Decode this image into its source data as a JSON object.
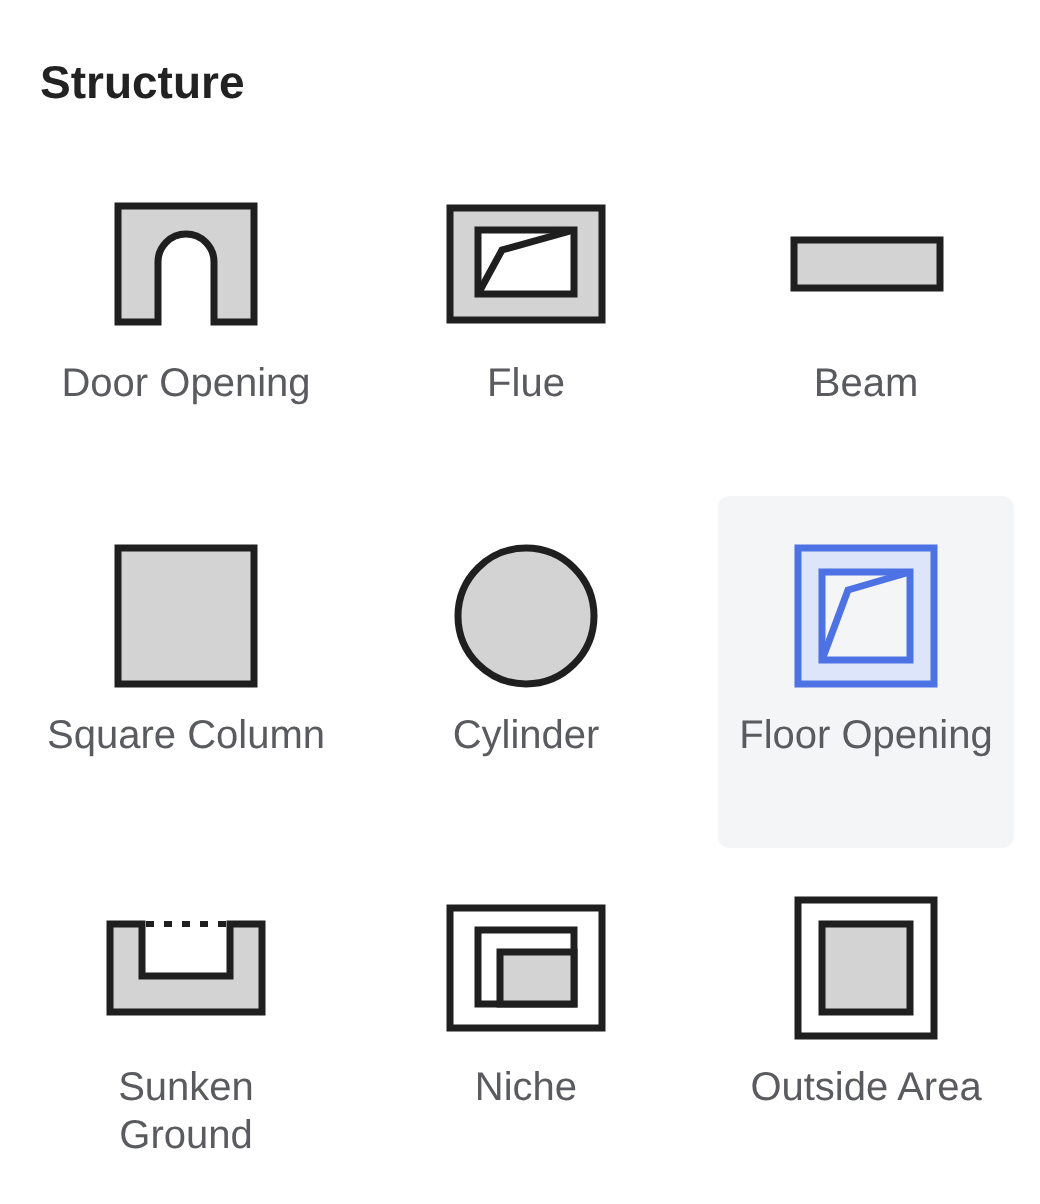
{
  "section": {
    "title": "Structure"
  },
  "items": [
    {
      "label": "Door Opening",
      "kind": "door-opening",
      "selected": false
    },
    {
      "label": "Flue",
      "kind": "flue",
      "selected": false
    },
    {
      "label": "Beam",
      "kind": "beam",
      "selected": false
    },
    {
      "label": "Square Column",
      "kind": "square-column",
      "selected": false
    },
    {
      "label": "Cylinder",
      "kind": "cylinder",
      "selected": false
    },
    {
      "label": "Floor Opening",
      "kind": "floor-opening",
      "selected": true
    },
    {
      "label": "Sunken Ground",
      "kind": "sunken-ground",
      "selected": false
    },
    {
      "label": "Niche",
      "kind": "niche",
      "selected": false
    },
    {
      "label": "Outside Area",
      "kind": "outside-area",
      "selected": false
    }
  ]
}
